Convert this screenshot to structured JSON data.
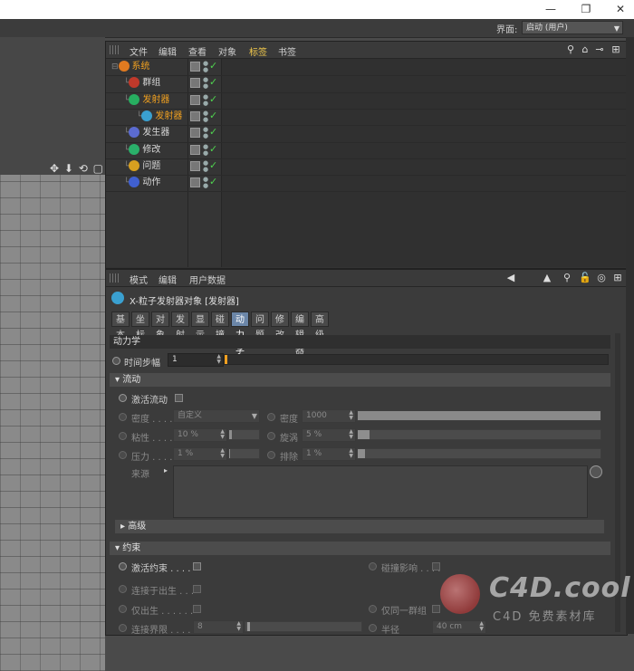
{
  "window": {
    "minimize_glyph": "—",
    "restore_glyph": "❐",
    "close_glyph": "✕"
  },
  "layout": {
    "label": "界面:",
    "value": "启动 (用户)"
  },
  "object_manager": {
    "menu": [
      "文件",
      "编辑",
      "查看",
      "对象",
      "标签",
      "书签"
    ],
    "active_menu": "标签",
    "objects": [
      {
        "name": "系统",
        "depth": 0,
        "selected": true,
        "icon_color": "#e07a20",
        "icon": "system-icon"
      },
      {
        "name": "群组",
        "depth": 1,
        "selected": false,
        "icon_color": "#c0392b",
        "icon": "group-icon"
      },
      {
        "name": "发射器",
        "depth": 1,
        "selected": true,
        "icon_color": "#27ae60",
        "icon": "emitter-icon"
      },
      {
        "name": "发射器",
        "depth": 2,
        "selected": true,
        "icon_color": "#3aa0d0",
        "icon": "particle-emitter-icon"
      },
      {
        "name": "发生器",
        "depth": 1,
        "selected": false,
        "icon_color": "#5b6bd0",
        "icon": "generator-icon"
      },
      {
        "name": "修改",
        "depth": 1,
        "selected": false,
        "icon_color": "#2ab06a",
        "icon": "modifier-icon"
      },
      {
        "name": "问题",
        "depth": 1,
        "selected": false,
        "icon_color": "#d8a020",
        "icon": "question-icon"
      },
      {
        "name": "动作",
        "depth": 1,
        "selected": false,
        "icon_color": "#4060d0",
        "icon": "action-icon"
      }
    ]
  },
  "attribute_manager": {
    "menu": [
      "模式",
      "编辑",
      "用户数据"
    ],
    "title": "X-粒子发射器对象 [发射器]",
    "tabs": [
      "基本",
      "坐标",
      "对象",
      "发射",
      "显示",
      "碰撞",
      "动力学",
      "问题",
      "修改",
      "编辑器",
      "高级"
    ],
    "active_tab": "动力学",
    "section": "动力学",
    "timestep": {
      "label": "时间步幅",
      "value": "1"
    },
    "flow": {
      "header": "流动",
      "activate": "激活流动",
      "density_mode_label": "密度 . . . .",
      "density_mode_value": "自定义",
      "density_label": "密度",
      "density_value": "1000",
      "viscosity_label": "粘性 . . . .",
      "viscosity_value": "10 %",
      "viscosity_level": 0.1,
      "vortex_label": "旋涡",
      "vortex_value": "5 %",
      "vortex_level": 0.05,
      "pressure_label": "压力 . . . .",
      "pressure_value": "1 %",
      "pressure_level": 0.01,
      "repel_label": "排除",
      "repel_value": "1 %",
      "repel_level": 0.01,
      "source_label": "来源"
    },
    "advanced": "高级",
    "constraints": {
      "header": "约束",
      "activate": "激活约束 . . . .",
      "collision": "碰撞影响 . . . .",
      "connect_birth": "连接于出生 . . .",
      "birth_only": "仅出生 . . . . . .",
      "same_group": "仅同一群组",
      "connect_bound": "连接界限 . . . .",
      "connect_bound_value": "8",
      "radius_label": "半径",
      "radius_value": "40 cm"
    }
  },
  "watermark": {
    "text": "C4D.cool",
    "sub": "C4D 免费素材库"
  }
}
